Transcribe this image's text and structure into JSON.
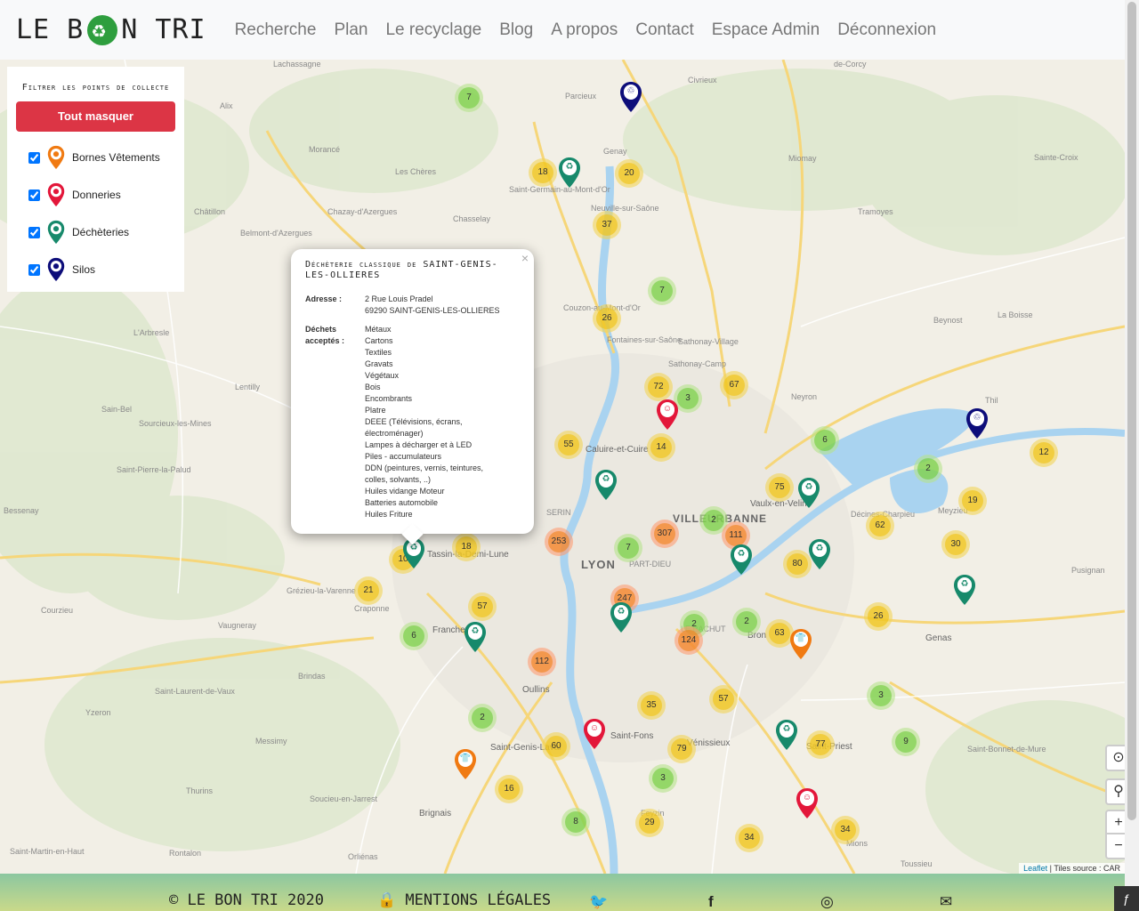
{
  "brand": {
    "left": "LE B",
    "right": "N TRI"
  },
  "nav": [
    "Recherche",
    "Plan",
    "Le recyclage",
    "Blog",
    "A propos",
    "Contact",
    "Espace Admin",
    "Déconnexion"
  ],
  "filter": {
    "title": "Filtrer les points de collecte",
    "hide_all": "Tout masquer",
    "items": [
      {
        "label": "Bornes Vêtements",
        "color": "#f07a12",
        "checked": true
      },
      {
        "label": "Donneries",
        "color": "#e3173a",
        "checked": true
      },
      {
        "label": "Déchèteries",
        "color": "#17896b",
        "checked": true
      },
      {
        "label": "Silos",
        "color": "#0d0d7a",
        "checked": true
      }
    ]
  },
  "popup": {
    "title": "Déchèterie classique de SAINT-GENIS-LES-OLLIERES",
    "address_label": "Adresse :",
    "address_line1": "2 Rue Louis Pradel",
    "address_line2": "69290 SAINT-GENIS-LES-OLLIERES",
    "waste_label_1": "Déchets",
    "waste_label_2": "acceptés :",
    "waste": [
      "Métaux",
      "Cartons",
      "Textiles",
      "Gravats",
      "Végétaux",
      "Bois",
      "Encombrants",
      "Platre",
      "DEEE (Télévisions, écrans,",
      "électroménager)",
      "Lampes à décharger et à LED",
      "Piles - accumulateurs",
      "DDN (peintures, vernis, teintures,",
      "colles, solvants, ..)",
      "Huiles vidange Moteur",
      "Batteries automobile",
      "Huiles Friture"
    ],
    "close": "×"
  },
  "places": {
    "lyon": "LYON",
    "villeurbanne": "VILLEURBANNE",
    "lachassagne": "Lachassagne",
    "alix": "Alix",
    "parcieux": "Parcieux",
    "civrieux": "Civrieux",
    "de_corcy": "de-Corcy",
    "morance": "Morancé",
    "les_cheres": "Les Chères",
    "genay": "Genay",
    "miomay": "Miomay",
    "sainte_croix": "Sainte-Croix",
    "chatillon": "Châtillon",
    "chazay": "Chazay-d'Azergues",
    "chasselay": "Chasselay",
    "st_germain": "Saint-Germain-au-Mont-d'Or",
    "neuville": "Neuville-sur-Saône",
    "tramoyes": "Tramoyes",
    "belmont": "Belmont-d'Azergues",
    "beynost": "Beynost",
    "la_boisse": "La Boisse",
    "larbresle": "L'Arbresle",
    "couzon": "Couzon-au-Mont-d'Or",
    "fontaines": "Fontaines-sur-Saône",
    "sathonay_v": "Sathonay-Village",
    "sathonay_c": "Sathonay-Camp",
    "neyron": "Neyron",
    "thil": "Thil",
    "lentilly": "Lentilly",
    "sain_bel": "Sain-Bel",
    "sourcieux": "Sourcieux-les-Mines",
    "caluire": "Caluire-et-Cuire",
    "st_pierre": "Saint-Pierre-la-Palud",
    "bessenay": "Bessenay",
    "vaulx": "Vaulx-en-Velin",
    "decines": "Décines-Charpieu",
    "meyzieu": "Meyzieu",
    "tassin": "Tassin-la-Demi-Lune",
    "serin": "SERIN",
    "part_dieu": "PART-DIEU",
    "pusignan": "Pusignan",
    "grezieu": "Grézieu-la-Varenne",
    "craponne": "Craponne",
    "courzieu": "Courzieu",
    "vaugneray": "Vaugneray",
    "francheville": "Francheville",
    "le_bachut": "LE BACHUT",
    "bron": "Bron",
    "genas": "Genas",
    "brindas": "Brindas",
    "oullins": "Oullins",
    "st_laurent": "Saint-Laurent-de-Vaux",
    "yzeron": "Yzeron",
    "messimy": "Messimy",
    "st_genis": "Saint-Genis-Laval",
    "st_fons": "Saint-Fons",
    "venissieux": "Vénissieux",
    "st_priest": "Saint-Priest",
    "st_bonnet": "Saint-Bonnet-de-Mure",
    "thurins": "Thurins",
    "soucieu": "Soucieu-en-Jarrest",
    "brignais": "Brignais",
    "feyzin": "Feyzin",
    "mions": "Mions",
    "st_martin": "Saint-Martin-en-Haut",
    "rontalon": "Rontalon",
    "orlienas": "Orliénas",
    "toussieu": "Toussieu"
  },
  "clusters": [
    {
      "n": "7",
      "c": "small"
    },
    {
      "n": "18",
      "c": "medium"
    },
    {
      "n": "20",
      "c": "medium"
    },
    {
      "n": "37",
      "c": "medium"
    },
    {
      "n": "7",
      "c": "small"
    },
    {
      "n": "26",
      "c": "medium"
    },
    {
      "n": "72",
      "c": "medium"
    },
    {
      "n": "3",
      "c": "small"
    },
    {
      "n": "67",
      "c": "medium"
    },
    {
      "n": "55",
      "c": "medium"
    },
    {
      "n": "14",
      "c": "medium"
    },
    {
      "n": "6",
      "c": "small"
    },
    {
      "n": "2",
      "c": "small"
    },
    {
      "n": "12",
      "c": "medium"
    },
    {
      "n": "75",
      "c": "medium"
    },
    {
      "n": "19",
      "c": "medium"
    },
    {
      "n": "2",
      "c": "small"
    },
    {
      "n": "62",
      "c": "medium"
    },
    {
      "n": "307",
      "c": "large"
    },
    {
      "n": "111",
      "c": "large"
    },
    {
      "n": "253",
      "c": "large"
    },
    {
      "n": "7",
      "c": "small"
    },
    {
      "n": "18",
      "c": "medium"
    },
    {
      "n": "10",
      "c": "medium"
    },
    {
      "n": "30",
      "c": "medium"
    },
    {
      "n": "80",
      "c": "medium"
    },
    {
      "n": "21",
      "c": "medium"
    },
    {
      "n": "247",
      "c": "large"
    },
    {
      "n": "57",
      "c": "medium"
    },
    {
      "n": "6",
      "c": "small"
    },
    {
      "n": "2",
      "c": "small"
    },
    {
      "n": "124",
      "c": "large"
    },
    {
      "n": "2",
      "c": "small"
    },
    {
      "n": "63",
      "c": "medium"
    },
    {
      "n": "26",
      "c": "medium"
    },
    {
      "n": "112",
      "c": "large"
    },
    {
      "n": "35",
      "c": "medium"
    },
    {
      "n": "57",
      "c": "medium"
    },
    {
      "n": "3",
      "c": "small"
    },
    {
      "n": "2",
      "c": "small"
    },
    {
      "n": "60",
      "c": "medium"
    },
    {
      "n": "79",
      "c": "medium"
    },
    {
      "n": "77",
      "c": "medium"
    },
    {
      "n": "9",
      "c": "small"
    },
    {
      "n": "16",
      "c": "medium"
    },
    {
      "n": "3",
      "c": "small"
    },
    {
      "n": "8",
      "c": "small"
    },
    {
      "n": "29",
      "c": "medium"
    },
    {
      "n": "34",
      "c": "medium"
    },
    {
      "n": "34",
      "c": "medium"
    }
  ],
  "pins": [
    {
      "type": "silo"
    },
    {
      "type": "decheterie"
    },
    {
      "type": "donnerie"
    },
    {
      "type": "silo"
    },
    {
      "type": "decheterie"
    },
    {
      "type": "decheterie"
    },
    {
      "type": "decheterie"
    },
    {
      "type": "decheterie"
    },
    {
      "type": "decheterie"
    },
    {
      "type": "decheterie"
    },
    {
      "type": "decheterie"
    },
    {
      "type": "decheterie"
    },
    {
      "type": "borne"
    },
    {
      "type": "donnerie"
    },
    {
      "type": "decheterie"
    },
    {
      "type": "borne"
    },
    {
      "type": "donnerie"
    }
  ],
  "pin_colors": {
    "silo": "#0d0d7a",
    "decheterie": "#17896b",
    "donnerie": "#e3173a",
    "borne": "#f07a12"
  },
  "controls": {
    "zoom_in": "+",
    "zoom_out": "−"
  },
  "attribution": {
    "leaflet": "Leaflet",
    "sep": " | ",
    "tiles": "Tiles source : CAR"
  },
  "footer": {
    "copyright": "© LE BON TRI 2020",
    "legal": "MENTIONS LÉGALES"
  }
}
